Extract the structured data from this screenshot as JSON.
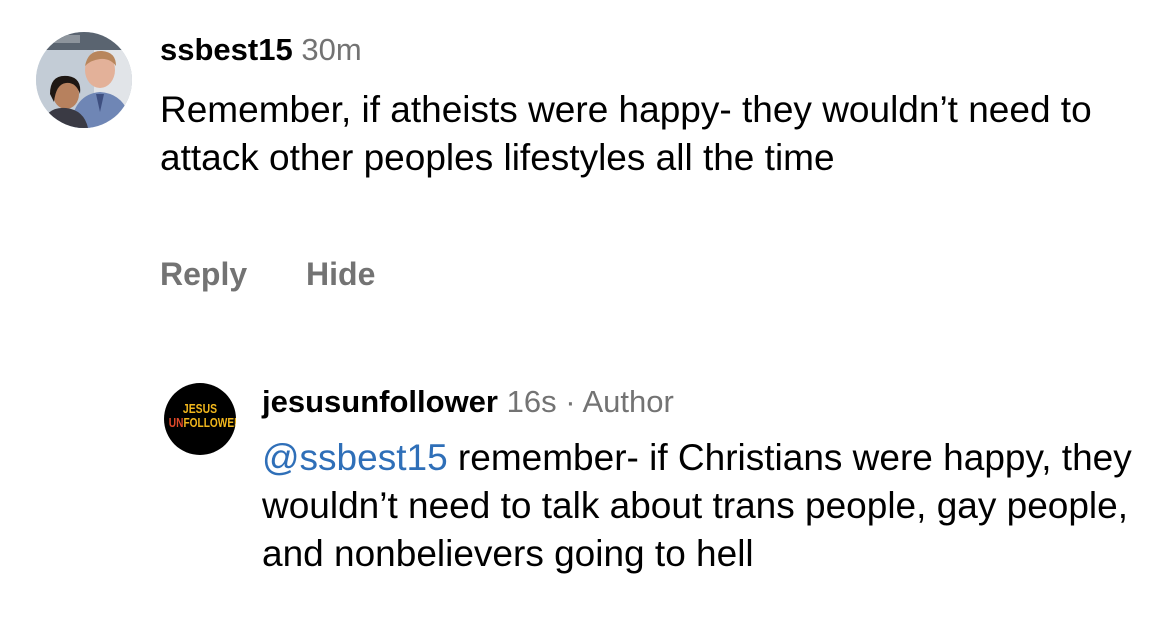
{
  "comment": {
    "username": "ssbest15",
    "time": "30m",
    "text": "Remember, if atheists were happy- they wouldn’t need to attack other peoples lifestyles all the time",
    "actions": {
      "reply": "Reply",
      "hide": "Hide"
    }
  },
  "reply": {
    "username": "jesusunfollower",
    "time": "16s",
    "separator": "·",
    "author_badge": "Author",
    "avatar_logo": {
      "top": "JESUS",
      "un": "UN",
      "follower": "FOLLOWER"
    },
    "mention": "@ssbest15",
    "text": " remember- if Christians were happy, they wouldn’t need to talk about trans people, gay people, and nonbelievers going to hell"
  },
  "colors": {
    "meta_gray": "#737373",
    "mention_blue": "#2f6fb8",
    "logo_yellow": "#f2b71c",
    "logo_red": "#e0492a"
  }
}
